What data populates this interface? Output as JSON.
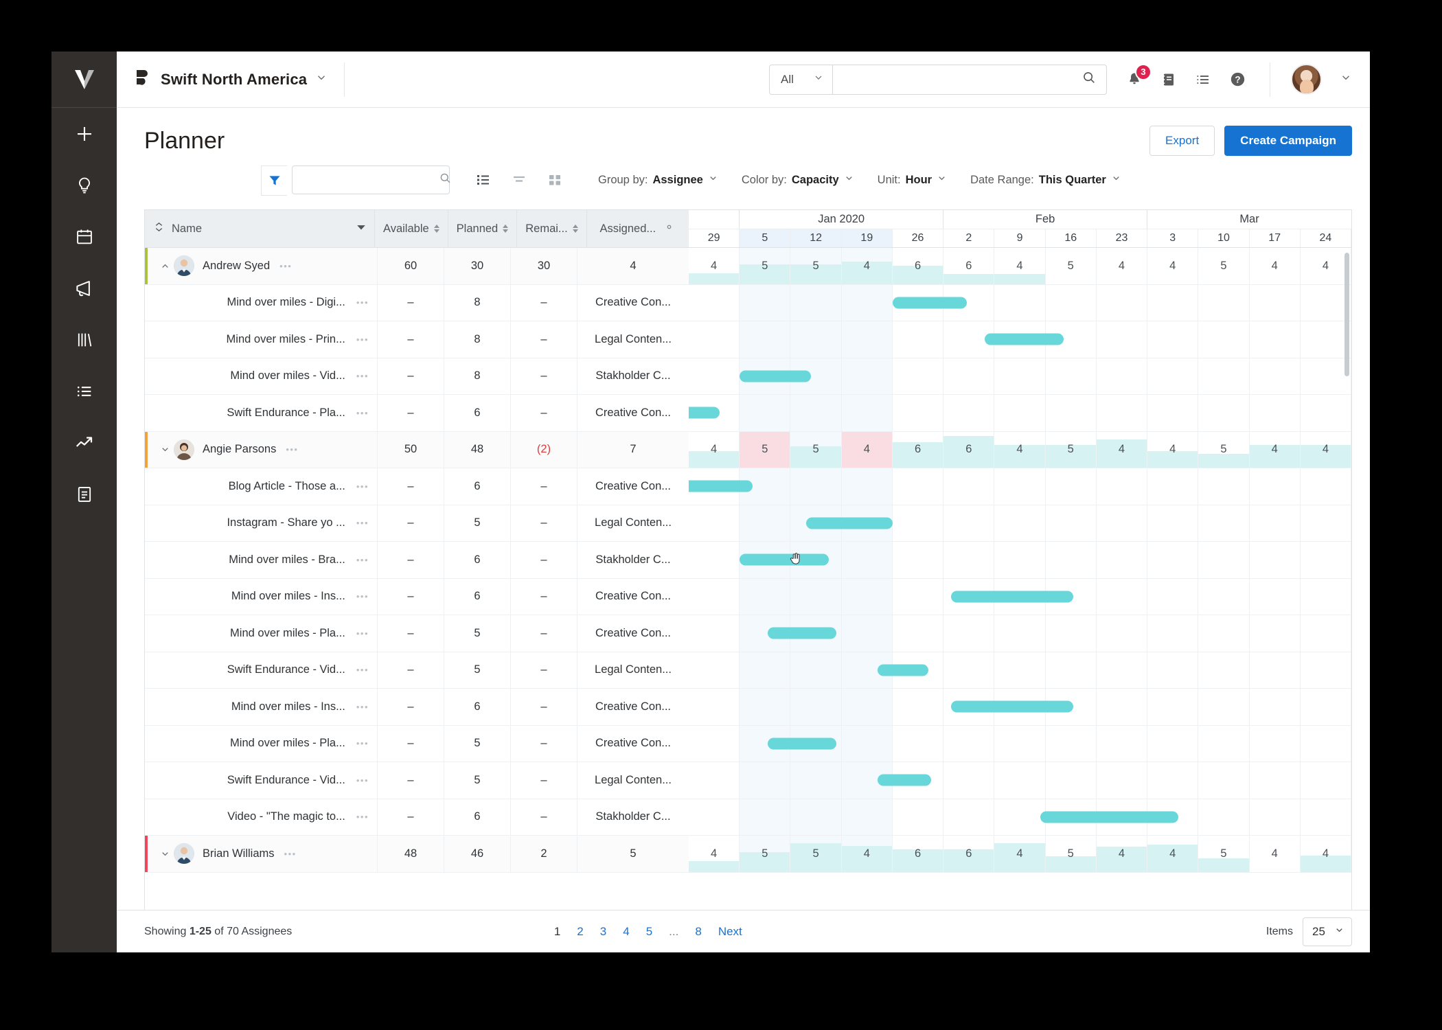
{
  "app": {
    "brand": "Swift North America",
    "logo_icon": "swift-logo-icon",
    "rail_logo_icon": "workfront-logo-icon"
  },
  "rail": {
    "items": [
      {
        "icon": "plus-icon",
        "name": "add"
      },
      {
        "icon": "lightbulb-icon",
        "name": "ideas"
      },
      {
        "icon": "calendar-icon",
        "name": "calendar"
      },
      {
        "icon": "megaphone-icon",
        "name": "campaigns"
      },
      {
        "icon": "library-icon",
        "name": "library"
      },
      {
        "icon": "list-icon",
        "name": "lists"
      },
      {
        "icon": "trending-up-icon",
        "name": "analytics"
      },
      {
        "icon": "document-icon",
        "name": "reports"
      }
    ]
  },
  "topbar": {
    "search_scope": "All",
    "search_placeholder": "",
    "search_value": "",
    "search_icon": "search-icon",
    "notifications_icon": "bell-icon",
    "notifications_count": "3",
    "notes_icon": "notebook-icon",
    "tasks_icon": "list-icon",
    "help_icon": "question-circle-icon",
    "avatar_name": "user-avatar",
    "chevron_icon": "chevron-down-icon"
  },
  "header": {
    "title": "Planner",
    "export_label": "Export",
    "create_label": "Create Campaign"
  },
  "toolbar": {
    "filter_icon": "filter-icon",
    "search_placeholder": "",
    "search_value": "",
    "search_icon": "search-icon",
    "view_icons": [
      "list-view-icon",
      "sort-view-icon",
      "grid-view-icon"
    ],
    "selects": [
      {
        "label": "Group by:",
        "value": "Assignee"
      },
      {
        "label": "Color by:",
        "value": "Capacity"
      },
      {
        "label": "Unit:",
        "value": "Hour"
      },
      {
        "label": "Date Range:",
        "value": "This Quarter"
      }
    ]
  },
  "grid": {
    "columns": [
      {
        "key": "name",
        "label": "Name",
        "sortable": false,
        "collapse_icon": "collapse-all-icon",
        "menu_icon": "caret-down-icon"
      },
      {
        "key": "available",
        "label": "Available",
        "sortable": true
      },
      {
        "key": "planned",
        "label": "Planned",
        "sortable": true
      },
      {
        "key": "remaining",
        "label": "Remai...",
        "sortable": true
      },
      {
        "key": "assigned",
        "label": "Assigned...",
        "sortable": false,
        "gear_icon": "gear-icon"
      }
    ],
    "timeline": {
      "months": [
        {
          "label": "",
          "weeks": 1
        },
        {
          "label": "Jan 2020",
          "weeks": 4
        },
        {
          "label": "Feb",
          "weeks": 4
        },
        {
          "label": "Mar",
          "weeks": 4
        }
      ],
      "weeks": [
        "29",
        "5",
        "12",
        "19",
        "26",
        "2",
        "9",
        "16",
        "23",
        "3",
        "10",
        "17",
        "24"
      ],
      "current_weeks": [
        1,
        2,
        3
      ]
    },
    "rows": [
      {
        "type": "group",
        "name": "Andrew Syed",
        "accent": "#a9c23f",
        "expanded": true,
        "caret": "chevron-up-icon",
        "available": "60",
        "planned": "30",
        "remaining": "30",
        "assigned": "4",
        "capacity": [
          {
            "v": "4",
            "fill": 0.3,
            "over": false
          },
          {
            "v": "5",
            "fill": 0.55,
            "over": false
          },
          {
            "v": "5",
            "fill": 0.55,
            "over": false
          },
          {
            "v": "4",
            "fill": 0.62,
            "over": false
          },
          {
            "v": "6",
            "fill": 0.5,
            "over": false
          },
          {
            "v": "6",
            "fill": 0.28,
            "over": false
          },
          {
            "v": "4",
            "fill": 0.28,
            "over": false
          },
          {
            "v": "5",
            "fill": 0.0,
            "over": false
          },
          {
            "v": "4",
            "fill": 0.0,
            "over": false
          },
          {
            "v": "4",
            "fill": 0.0,
            "over": false
          },
          {
            "v": "5",
            "fill": 0.0,
            "over": false
          },
          {
            "v": "4",
            "fill": 0.0,
            "over": false
          },
          {
            "v": "4",
            "fill": 0.0,
            "over": false
          }
        ]
      },
      {
        "type": "task",
        "name": "Mind over miles - Digi...",
        "available": "–",
        "planned": "8",
        "remaining": "–",
        "assigned": "Creative Con...",
        "bar": {
          "start": 4.0,
          "span": 1.45
        }
      },
      {
        "type": "task",
        "name": "Mind over miles - Prin...",
        "available": "–",
        "planned": "8",
        "remaining": "–",
        "assigned": "Legal Conten...",
        "bar": {
          "start": 5.8,
          "span": 1.55
        }
      },
      {
        "type": "task",
        "name": "Mind over miles -  Vid...",
        "available": "–",
        "planned": "8",
        "remaining": "–",
        "assigned": "Stakholder C...",
        "bar": {
          "start": 1.0,
          "span": 1.4
        }
      },
      {
        "type": "task",
        "name": "Swift Endurance - Pla...",
        "available": "–",
        "planned": "6",
        "remaining": "–",
        "assigned": "Creative Con...",
        "bar": {
          "start": -0.3,
          "span": 0.9
        }
      },
      {
        "type": "group",
        "name": "Angie Parsons",
        "accent": "#f2a13c",
        "expanded": true,
        "caret": "chevron-down-icon",
        "available": "50",
        "planned": "48",
        "remaining": "(2)",
        "remaining_negative": true,
        "assigned": "7",
        "capacity": [
          {
            "v": "4",
            "fill": 0.45,
            "over": false
          },
          {
            "v": "5",
            "fill": 1.0,
            "over": true
          },
          {
            "v": "5",
            "fill": 0.6,
            "over": false
          },
          {
            "v": "4",
            "fill": 1.0,
            "over": true
          },
          {
            "v": "6",
            "fill": 0.7,
            "over": false
          },
          {
            "v": "6",
            "fill": 0.88,
            "over": false
          },
          {
            "v": "4",
            "fill": 0.62,
            "over": false
          },
          {
            "v": "5",
            "fill": 0.62,
            "over": false
          },
          {
            "v": "4",
            "fill": 0.78,
            "over": false
          },
          {
            "v": "4",
            "fill": 0.45,
            "over": false
          },
          {
            "v": "5",
            "fill": 0.38,
            "over": false
          },
          {
            "v": "4",
            "fill": 0.62,
            "over": false
          },
          {
            "v": "4",
            "fill": 0.62,
            "over": false
          }
        ]
      },
      {
        "type": "task",
        "name": "Blog Article - Those a...",
        "available": "–",
        "planned": "6",
        "remaining": "–",
        "assigned": "Creative Con...",
        "bar": {
          "start": -0.3,
          "span": 1.55
        }
      },
      {
        "type": "task",
        "name": "Instagram - Share yo ...",
        "available": "–",
        "planned": "5",
        "remaining": "–",
        "assigned": "Legal Conten...",
        "bar": {
          "start": 2.3,
          "span": 1.7
        }
      },
      {
        "type": "task",
        "name": "Mind over miles - Bra...",
        "available": "–",
        "planned": "6",
        "remaining": "–",
        "assigned": "Stakholder C...",
        "bar": {
          "start": 1.0,
          "span": 1.75
        },
        "cursor": true
      },
      {
        "type": "task",
        "name": "Mind over miles - Ins...",
        "available": "–",
        "planned": "6",
        "remaining": "–",
        "assigned": "Creative Con...",
        "bar": {
          "start": 5.15,
          "span": 2.4
        }
      },
      {
        "type": "task",
        "name": "Mind over miles - Pla...",
        "available": "–",
        "planned": "5",
        "remaining": "–",
        "assigned": "Creative Con...",
        "bar": {
          "start": 1.55,
          "span": 1.35
        }
      },
      {
        "type": "task",
        "name": "Swift Endurance - Vid...",
        "available": "–",
        "planned": "5",
        "remaining": "–",
        "assigned": "Legal Conten...",
        "bar": {
          "start": 3.7,
          "span": 1.0
        }
      },
      {
        "type": "task",
        "name": "Mind over miles - Ins...",
        "available": "–",
        "planned": "6",
        "remaining": "–",
        "assigned": "Creative Con...",
        "bar": {
          "start": 5.15,
          "span": 2.4
        }
      },
      {
        "type": "task",
        "name": "Mind over miles - Pla...",
        "available": "–",
        "planned": "5",
        "remaining": "–",
        "assigned": "Creative Con...",
        "bar": {
          "start": 1.55,
          "span": 1.35
        }
      },
      {
        "type": "task",
        "name": "Swift Endurance - Vid...",
        "available": "–",
        "planned": "5",
        "remaining": "–",
        "assigned": "Legal Conten...",
        "bar": {
          "start": 3.7,
          "span": 1.05
        }
      },
      {
        "type": "task",
        "name": "Video - \"The magic to...",
        "available": "–",
        "planned": "6",
        "remaining": "–",
        "assigned": "Stakholder C...",
        "bar": {
          "start": 6.9,
          "span": 2.7
        }
      },
      {
        "type": "group",
        "name": "Brian Williams",
        "accent": "#f0465c",
        "expanded": true,
        "caret": "chevron-down-icon",
        "available": "48",
        "planned": "46",
        "remaining": "2",
        "assigned": "5",
        "capacity": [
          {
            "v": "4",
            "fill": 0.3,
            "over": false
          },
          {
            "v": "5",
            "fill": 0.55,
            "over": false
          },
          {
            "v": "5",
            "fill": 0.8,
            "over": false
          },
          {
            "v": "4",
            "fill": 0.72,
            "over": false
          },
          {
            "v": "6",
            "fill": 0.62,
            "over": false
          },
          {
            "v": "6",
            "fill": 0.62,
            "over": false
          },
          {
            "v": "4",
            "fill": 0.8,
            "over": false
          },
          {
            "v": "5",
            "fill": 0.42,
            "over": false
          },
          {
            "v": "4",
            "fill": 0.7,
            "over": false
          },
          {
            "v": "4",
            "fill": 0.75,
            "over": false
          },
          {
            "v": "5",
            "fill": 0.38,
            "over": false
          },
          {
            "v": "4",
            "fill": 0.0,
            "over": false
          },
          {
            "v": "4",
            "fill": 0.45,
            "over": false
          }
        ]
      }
    ]
  },
  "footer": {
    "showing_prefix": "Showing ",
    "showing_range": "1-25",
    "showing_suffix": " of 70 Assignees",
    "pages": [
      "1",
      "2",
      "3",
      "4",
      "5",
      "...",
      "8"
    ],
    "current_page": "1",
    "next_label": "Next",
    "items_label": "Items",
    "items_value": "25"
  },
  "colors": {
    "accent_blue": "#1673d2",
    "bar_teal": "#67d7da",
    "capacity_fill": "#d6f2f3",
    "capacity_over": "#fadde3",
    "badge_red": "#e0214f"
  }
}
